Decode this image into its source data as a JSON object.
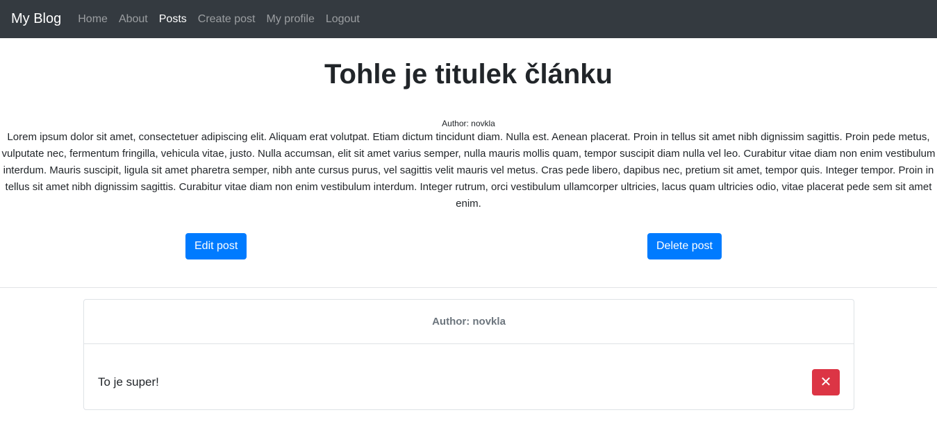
{
  "navbar": {
    "brand": "My Blog",
    "links": [
      "Home",
      "About",
      "Posts",
      "Create post",
      "My profile",
      "Logout"
    ],
    "active": "Posts"
  },
  "post": {
    "title": "Tohle je titulek článku",
    "author": "Author: novkla",
    "body": "Lorem ipsum dolor sit amet, consectetuer adipiscing elit. Aliquam erat volutpat. Etiam dictum tincidunt diam. Nulla est. Aenean placerat. Proin in tellus sit amet nibh dignissim sagittis. Proin pede metus, vulputate nec, fermentum fringilla, vehicula vitae, justo. Nulla accumsan, elit sit amet varius semper, nulla mauris mollis quam, tempor suscipit diam nulla vel leo. Curabitur vitae diam non enim vestibulum interdum. Mauris suscipit, ligula sit amet pharetra semper, nibh ante cursus purus, vel sagittis velit mauris vel metus. Cras pede libero, dapibus nec, pretium sit amet, tempor quis. Integer tempor. Proin in tellus sit amet nibh dignissim sagittis. Curabitur vitae diam non enim vestibulum interdum. Integer rutrum, orci vestibulum ullamcorper ultricies, lacus quam ultricies odio, vitae placerat pede sem sit amet enim.",
    "edit_label": "Edit post",
    "delete_label": "Delete post"
  },
  "comment": {
    "author": "Author: novkla",
    "text": "To je super!",
    "delete_icon": "close-icon",
    "delete_glyph": "✕"
  },
  "colors": {
    "navbar_bg": "#343a40",
    "primary": "#007bff",
    "danger": "#dc3545"
  }
}
